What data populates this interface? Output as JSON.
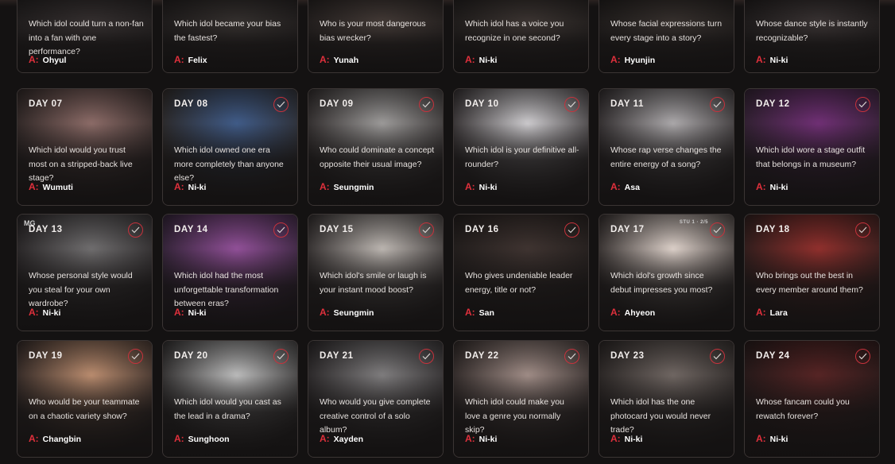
{
  "answer_prefix": "A:",
  "cards": [
    {
      "day": "",
      "question": "Which idol could turn a non-fan into a fan with one performance?",
      "answer": "Ohyul",
      "bg": [
        "#3a3434",
        "#221f1f"
      ],
      "checked": false
    },
    {
      "day": "",
      "question": "Which idol became your bias the fastest?",
      "answer": "Felix",
      "bg": [
        "#3a3533",
        "#1f1c1c"
      ],
      "checked": false
    },
    {
      "day": "",
      "question": "Who is your most dangerous bias wrecker?",
      "answer": "Yunah",
      "bg": [
        "#4a403c",
        "#231f1e"
      ],
      "checked": false
    },
    {
      "day": "",
      "question": "Which idol has a voice you recognize in one second?",
      "answer": "Ni-ki",
      "bg": [
        "#423a37",
        "#201d1c"
      ],
      "checked": false
    },
    {
      "day": "",
      "question": "Whose facial expressions turn every stage into a story?",
      "answer": "Hyunjin",
      "bg": [
        "#3c3532",
        "#1f1c1b"
      ],
      "checked": false
    },
    {
      "day": "",
      "question": "Whose dance style is instantly recognizable?",
      "answer": "Ni-ki",
      "bg": [
        "#3f3838",
        "#1e1b1b"
      ],
      "checked": false
    },
    {
      "day": "DAY 07",
      "question": "Which idol would you trust most on a stripped-back live stage?",
      "answer": "Wumuti",
      "bg": [
        "#8a6a66",
        "#2a2322"
      ],
      "checked": false
    },
    {
      "day": "DAY 08",
      "question": "Which idol owned one era more completely than anyone else?",
      "answer": "Ni-ki",
      "bg": [
        "#3f5a86",
        "#2a2624"
      ],
      "checked": true
    },
    {
      "day": "DAY 09",
      "question": "Who could dominate a concept opposite their usual image?",
      "answer": "Seungmin",
      "bg": [
        "#9a9897",
        "#2b2727"
      ],
      "checked": true
    },
    {
      "day": "DAY 10",
      "question": "Which idol is your definitive all-rounder?",
      "answer": "Ni-ki",
      "bg": [
        "#c9c7ca",
        "#2e2a2b"
      ],
      "checked": true
    },
    {
      "day": "DAY 11",
      "question": "Whose rap verse changes the entire energy of a song?",
      "answer": "Asa",
      "bg": [
        "#a9a6a8",
        "#2a2627"
      ],
      "checked": true
    },
    {
      "day": "DAY 12",
      "question": "Which idol wore a stage outfit that belongs in a museum?",
      "answer": "Ni-ki",
      "bg": [
        "#6e2f73",
        "#2c1f2c"
      ],
      "checked": true
    },
    {
      "day": "DAY 13",
      "question": "Whose personal style would you steal for your own wardrobe?",
      "answer": "Ni-ki",
      "bg": [
        "#6e6c6d",
        "#242122"
      ],
      "checked": true,
      "mark": "MG"
    },
    {
      "day": "DAY 14",
      "question": "Which idol had the most unforgettable transformation between eras?",
      "answer": "Ni-ki",
      "bg": [
        "#8f4f96",
        "#2c2030"
      ],
      "checked": true
    },
    {
      "day": "DAY 15",
      "question": "Which idol's smile or laugh is your instant mood boost?",
      "answer": "Seungmin",
      "bg": [
        "#b9b3ae",
        "#2c2828"
      ],
      "checked": true
    },
    {
      "day": "DAY 16",
      "question": "Who gives undeniable leader energy, title or not?",
      "answer": "San",
      "bg": [
        "#3e3330",
        "#1f1b1a"
      ],
      "checked": true
    },
    {
      "day": "DAY 17",
      "question": "Which idol's growth since debut impresses you most?",
      "answer": "Ahyeon",
      "bg": [
        "#d9cdc6",
        "#2d2827"
      ],
      "checked": true,
      "mark2": "STU  1  · 2/5"
    },
    {
      "day": "DAY 18",
      "question": "Who brings out the best in every member around them?",
      "answer": "Lara",
      "bg": [
        "#8e2f2c",
        "#2a1c1b"
      ],
      "checked": true
    },
    {
      "day": "DAY 19",
      "question": "Who would be your teammate on a chaotic variety show?",
      "answer": "Changbin",
      "bg": [
        "#b78a6d",
        "#2c2422"
      ],
      "checked": true
    },
    {
      "day": "DAY 20",
      "question": "Which idol would you cast as the lead in a drama?",
      "answer": "Sunghoon",
      "bg": [
        "#b8b8b8",
        "#2a2828"
      ],
      "checked": true
    },
    {
      "day": "DAY 21",
      "question": "Who would you give complete creative control of a solo album?",
      "answer": "Xayden",
      "bg": [
        "#7d7b7c",
        "#252223"
      ],
      "checked": true
    },
    {
      "day": "DAY 22",
      "question": "Which idol could make you love a genre you normally skip?",
      "answer": "Ni-ki",
      "bg": [
        "#9d8a84",
        "#2a2423"
      ],
      "checked": true
    },
    {
      "day": "DAY 23",
      "question": "Which idol has the one photocard you would never trade?",
      "answer": "Ni-ki",
      "bg": [
        "#6e6561",
        "#252120"
      ],
      "checked": true
    },
    {
      "day": "DAY 24",
      "question": "Whose fancam could you rewatch forever?",
      "answer": "Ni-ki",
      "bg": [
        "#552424",
        "#221818"
      ],
      "checked": true
    }
  ]
}
